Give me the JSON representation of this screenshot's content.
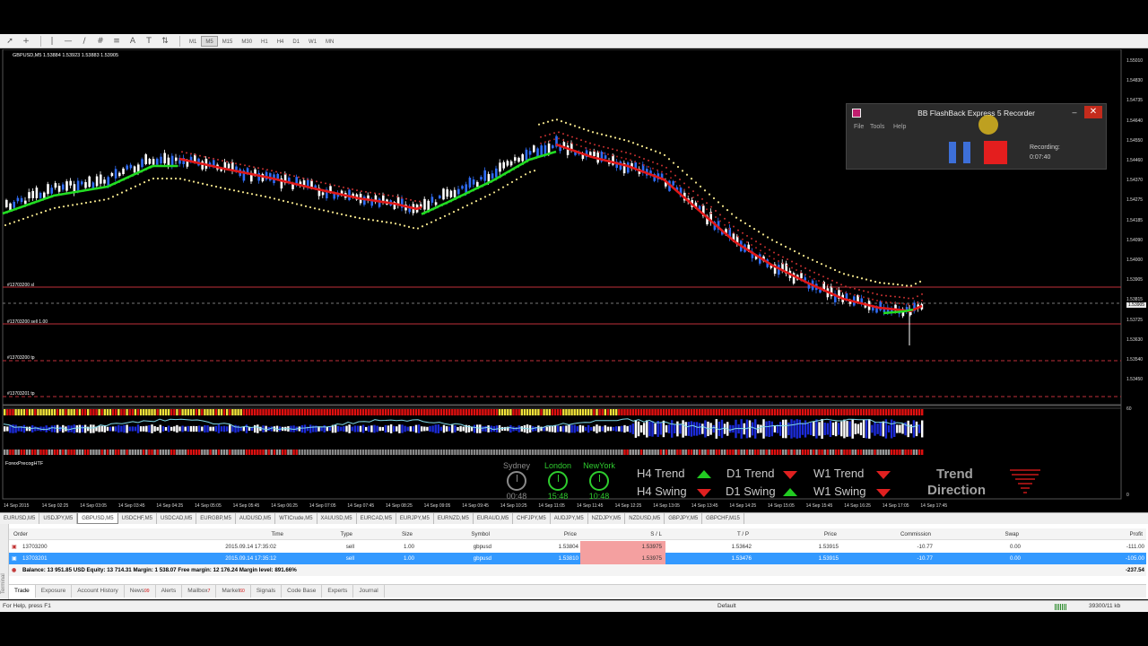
{
  "toolbar": {
    "timeframes": [
      "M1",
      "M5",
      "M15",
      "M30",
      "H1",
      "H4",
      "D1",
      "W1",
      "MN"
    ],
    "active_timeframe": "M5"
  },
  "chart": {
    "info_line": "GBPUSD,M5  1.53884 1.53923 1.53883 1.53905",
    "subwindow_label": "ForexPrecogHTF",
    "order_lines": {
      "sl": "#13703200 sl",
      "sell": "#13703200 sell 1.00",
      "tp1": "#13703200 tp",
      "tp2": "#13703201 tp"
    },
    "price_scale": [
      "1.55010",
      "1.54830",
      "1.54735",
      "1.54640",
      "1.54550",
      "1.54460",
      "1.54370",
      "1.54275",
      "1.54185",
      "1.54090",
      "1.54000",
      "1.53905",
      "1.53815",
      "1.53725",
      "1.53630",
      "1.53540",
      "1.53450"
    ],
    "current_price": "1.53905",
    "subwindow_scale": [
      "60",
      "0"
    ],
    "time_labels": [
      "14 Sep 2015",
      "14 Sep 02:25",
      "14 Sep 03:05",
      "14 Sep 03:45",
      "14 Sep 04:25",
      "14 Sep 05:05",
      "14 Sep 05:45",
      "14 Sep 06:25",
      "14 Sep 07:05",
      "14 Sep 07:45",
      "14 Sep 08:25",
      "14 Sep 09:05",
      "14 Sep 09:45",
      "14 Sep 10:25",
      "14 Sep 11:05",
      "14 Sep 11:45",
      "14 Sep 12:25",
      "14 Sep 13:05",
      "14 Sep 13:45",
      "14 Sep 14:25",
      "14 Sep 15:05",
      "14 Sep 15:45",
      "14 Sep 16:25",
      "14 Sep 17:05",
      "14 Sep 17:45"
    ]
  },
  "clocks": [
    {
      "name": "Sydney",
      "time": "00:48",
      "color": "#8a8a8a"
    },
    {
      "name": "London",
      "time": "15:48",
      "color": "#2ecc2e"
    },
    {
      "name": "NewYork",
      "time": "10:48",
      "color": "#2ecc2e"
    }
  ],
  "trend_panel": {
    "h4_trend": "H4 Trend",
    "h4_swing": "H4 Swing",
    "d1_trend": "D1 Trend",
    "d1_swing": "D1 Swing",
    "w1_trend": "W1 Trend",
    "w1_swing": "W1 Swing",
    "direction_title": "Trend",
    "direction_subtitle": "Direction"
  },
  "recorder": {
    "title": "BB FlashBack Express 5 Recorder",
    "menu": [
      "File",
      "Tools",
      "Help"
    ],
    "status_label": "Recording:",
    "elapsed": "0:07:40"
  },
  "symbol_tabs": [
    "EURUSD,M5",
    "USDJPY,M5",
    "GBPUSD,M5",
    "USDCHF,M5",
    "USDCAD,M5",
    "EURGBP,M5",
    "AUDUSD,M5",
    "WTICrude,M5",
    "XAUUSD,M5",
    "EURCAD,M5",
    "EURJPY,M5",
    "EURNZD,M5",
    "EURAUD,M5",
    "CHFJPY,M5",
    "AUDJPY,M5",
    "NZDJPY,M5",
    "NZDUSD,M5",
    "GBPJPY,M5",
    "GBPCHF,M15"
  ],
  "active_symbol_tab": "GBPUSD,M5",
  "terminal": {
    "side_label": "Terminal",
    "columns": [
      "Order",
      "Time",
      "Type",
      "Size",
      "Symbol",
      "Price",
      "S / L",
      "T / P",
      "Price",
      "Commission",
      "Swap",
      "Profit"
    ],
    "orders": [
      {
        "order": "13703200",
        "time": "2015.09.14 17:35:02",
        "type": "sell",
        "size": "1.00",
        "symbol": "gbpusd",
        "price": "1.53804",
        "sl": "1.53975",
        "tp": "1.53642",
        "cur_price": "1.53915",
        "commission": "-10.77",
        "swap": "0.00",
        "profit": "-111.00"
      },
      {
        "order": "13703201",
        "time": "2015.09.14 17:35:12",
        "type": "sell",
        "size": "1.00",
        "symbol": "gbpusd",
        "price": "1.53810",
        "sl": "1.53975",
        "tp": "1.53476",
        "cur_price": "1.53915",
        "commission": "-10.77",
        "swap": "0.00",
        "profit": "-105.00"
      }
    ],
    "balance_line": "Balance: 13 951.85 USD  Equity: 13 714.31  Margin: 1 538.07  Free margin: 12 176.24  Margin level: 891.66%",
    "total_profit": "-237.54",
    "tabs": [
      {
        "label": "Trade",
        "badge": ""
      },
      {
        "label": "Exposure",
        "badge": ""
      },
      {
        "label": "Account History",
        "badge": ""
      },
      {
        "label": "News",
        "badge": "99"
      },
      {
        "label": "Alerts",
        "badge": ""
      },
      {
        "label": "Mailbox",
        "badge": "7"
      },
      {
        "label": "Market",
        "badge": "60"
      },
      {
        "label": "Signals",
        "badge": ""
      },
      {
        "label": "Code Base",
        "badge": ""
      },
      {
        "label": "Experts",
        "badge": ""
      },
      {
        "label": "Journal",
        "badge": ""
      }
    ],
    "active_tab": "Trade"
  },
  "status_bar": {
    "help": "For Help, press F1",
    "profile": "Default",
    "traffic": "39300/11 kb"
  },
  "colors": {
    "bull_candle": "#2f6cf5",
    "bear_candle": "#ffffff",
    "uptrend_line": "#22dd22",
    "downtrend_line": "#e01818",
    "dots": "#f0e28a",
    "order_line": "#c0303a"
  }
}
